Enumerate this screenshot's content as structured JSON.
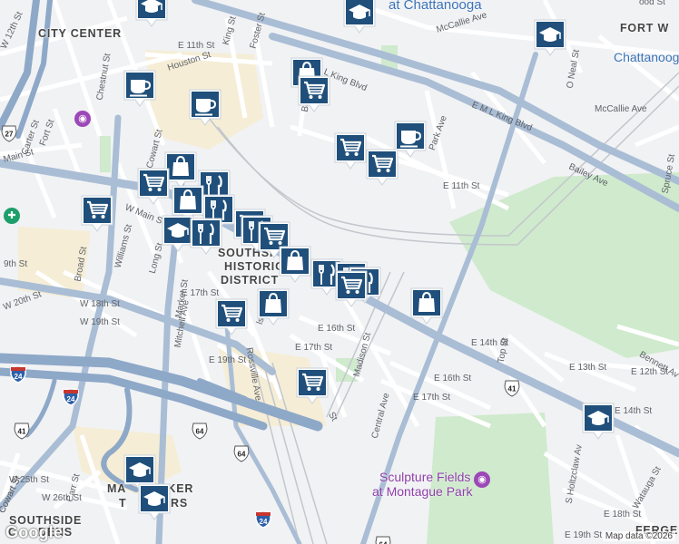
{
  "map": {
    "attribution": "Map data ©2026",
    "logo": "Google",
    "colors": {
      "highway": "#8ea8c8",
      "major": "#a9bdd5",
      "park": "#cfeacd",
      "campus": "#f5edd6",
      "pin": "#1f4f7a",
      "water": "#a6d4f0",
      "poi": "#8e3fa8"
    }
  },
  "areas": {
    "city_center": "CITY CENTER",
    "fort_wood": "FORT W",
    "southside_historic_1": "SOUTHSI",
    "southside_historic_2": "HISTORIC",
    "southside_historic_3": "DISTRICT",
    "main_street_1": "MA",
    "main_street_2": "LKER",
    "main_street_3": "T",
    "main_street_4": "RS",
    "southside_1": "SOUTHSIDE",
    "southside_2": "G",
    "southside_3": "DENS",
    "fergeson": "FERGE"
  },
  "pois": {
    "utc": "at Chattanooga",
    "chattanooga_right": "Chattanoog",
    "sculpture_1": "Sculpture Fields",
    "sculpture_2": "at Montague Park"
  },
  "streets": [
    {
      "id": "mccallie-1",
      "text": "McCallie Ave"
    },
    {
      "id": "mccallie-2",
      "text": "McCallie Ave"
    },
    {
      "id": "mlk-1",
      "text": "E M L King Blvd"
    },
    {
      "id": "mlk-2",
      "text": "E M L King Blvd"
    },
    {
      "id": "bailey",
      "text": "Bailey Ave"
    },
    {
      "id": "w-main",
      "text": "W Main St"
    },
    {
      "id": "main",
      "text": "Main St"
    },
    {
      "id": "e-11th-1",
      "text": "E 11th St"
    },
    {
      "id": "e-11th-2",
      "text": "E 11th St"
    },
    {
      "id": "w-12th",
      "text": "W 12th St"
    },
    {
      "id": "houston",
      "text": "Houston St"
    },
    {
      "id": "king",
      "text": "King St"
    },
    {
      "id": "foster",
      "text": "Foster St"
    },
    {
      "id": "baldwin",
      "text": "Baldwin St"
    },
    {
      "id": "park-ave",
      "text": "Park Ave"
    },
    {
      "id": "o-neal",
      "text": "O Neal St"
    },
    {
      "id": "spruce",
      "text": "Spruce St"
    },
    {
      "id": "chestnut",
      "text": "Chestnut St"
    },
    {
      "id": "carter",
      "text": "Carter St"
    },
    {
      "id": "fort",
      "text": "Fort St"
    },
    {
      "id": "cowart-1",
      "text": "Cowart St"
    },
    {
      "id": "cowart-2",
      "text": "Cowart St"
    },
    {
      "id": "broad",
      "text": "Broad St"
    },
    {
      "id": "williams",
      "text": "Williams St"
    },
    {
      "id": "long",
      "text": "Long St"
    },
    {
      "id": "market",
      "text": "Market St"
    },
    {
      "id": "mitchell",
      "text": "Mitchell Ave"
    },
    {
      "id": "rossville",
      "text": "Rossville Ave"
    },
    {
      "id": "w-20th",
      "text": "W 20th St"
    },
    {
      "id": "w-18th",
      "text": "W 18th St"
    },
    {
      "id": "w-19th",
      "text": "W 19th St"
    },
    {
      "id": "e-17th-w",
      "text": "E 17th St"
    },
    {
      "id": "e-19th",
      "text": "E 19th St"
    },
    {
      "id": "e-16th-1",
      "text": "E 16th St"
    },
    {
      "id": "e-17th-1",
      "text": "E 17th St"
    },
    {
      "id": "madison",
      "text": "Madison St"
    },
    {
      "id": "central",
      "text": "Central Ave"
    },
    {
      "id": "e-14th-1",
      "text": "E 14th St"
    },
    {
      "id": "e-16th-2",
      "text": "E 16th St"
    },
    {
      "id": "e-17th-2",
      "text": "E 17th St"
    },
    {
      "id": "top",
      "text": "Top St"
    },
    {
      "id": "e-13th",
      "text": "E 13th St"
    },
    {
      "id": "e-12th",
      "text": "E 12th St"
    },
    {
      "id": "bennett",
      "text": "Bennett Av"
    },
    {
      "id": "e-14th-2",
      "text": "E 14th St"
    },
    {
      "id": "holtzclaw",
      "text": "S Holtzclaw Av"
    },
    {
      "id": "e-18th",
      "text": "E 18th St"
    },
    {
      "id": "e-19th-2",
      "text": "E 19th St"
    },
    {
      "id": "watauga",
      "text": "Watauga St"
    },
    {
      "id": "w-25th",
      "text": "W 25th St"
    },
    {
      "id": "w-26th",
      "text": "W 26th St"
    },
    {
      "id": "carr",
      "text": "Carr St"
    },
    {
      "id": "cowart-3",
      "text": "Cowart St"
    },
    {
      "id": "19th-w",
      "text": "9th St"
    },
    {
      "id": "wood",
      "text": "ood St"
    },
    {
      "id": "st-mid",
      "text": "St"
    },
    {
      "id": "ls",
      "text": "ls"
    }
  ],
  "shields": [
    {
      "id": "i24-a",
      "text": "24",
      "kind": "interstate"
    },
    {
      "id": "i24-b",
      "text": "24",
      "kind": "interstate"
    },
    {
      "id": "i24-c",
      "text": "24",
      "kind": "interstate"
    },
    {
      "id": "us41-a",
      "text": "41",
      "kind": "us"
    },
    {
      "id": "us41-b",
      "text": "41",
      "kind": "us"
    },
    {
      "id": "us64-a",
      "text": "64",
      "kind": "us"
    },
    {
      "id": "us64-b",
      "text": "64",
      "kind": "us"
    },
    {
      "id": "us64-c",
      "text": "64",
      "kind": "us"
    },
    {
      "id": "us27",
      "text": "27",
      "kind": "us"
    }
  ],
  "pins": [
    {
      "id": "p1",
      "icon": "graduation-cap-icon"
    },
    {
      "id": "p2",
      "icon": "graduation-cap-icon"
    },
    {
      "id": "p3",
      "icon": "graduation-cap-icon"
    },
    {
      "id": "p4",
      "icon": "shopping-bag-icon"
    },
    {
      "id": "p5",
      "icon": "shopping-cart-icon"
    },
    {
      "id": "p6",
      "icon": "coffee-cup-icon"
    },
    {
      "id": "p7",
      "icon": "coffee-cup-icon"
    },
    {
      "id": "p8",
      "icon": "coffee-cup-icon"
    },
    {
      "id": "p9",
      "icon": "shopping-cart-icon"
    },
    {
      "id": "p10",
      "icon": "shopping-cart-icon"
    },
    {
      "id": "p11",
      "icon": "shopping-bag-icon"
    },
    {
      "id": "p12",
      "icon": "shopping-cart-icon"
    },
    {
      "id": "p13",
      "icon": "fork-knife-icon"
    },
    {
      "id": "p14",
      "icon": "shopping-bag-icon"
    },
    {
      "id": "p15",
      "icon": "shopping-cart-icon"
    },
    {
      "id": "p16",
      "icon": "fork-knife-icon"
    },
    {
      "id": "p17",
      "icon": "graduation-cap-icon"
    },
    {
      "id": "p18",
      "icon": "fork-knife-icon"
    },
    {
      "id": "p19",
      "icon": "shopping-cart-icon"
    },
    {
      "id": "p20",
      "icon": "fork-knife-icon"
    },
    {
      "id": "p21",
      "icon": "shopping-cart-icon"
    },
    {
      "id": "p22",
      "icon": "shopping-bag-icon"
    },
    {
      "id": "p23",
      "icon": "fork-knife-icon"
    },
    {
      "id": "p24",
      "icon": "shopping-cart-icon"
    },
    {
      "id": "p25",
      "icon": "fork-knife-icon"
    },
    {
      "id": "p26",
      "icon": "fork-knife-icon"
    },
    {
      "id": "p27",
      "icon": "shopping-bag-icon"
    },
    {
      "id": "p28",
      "icon": "shopping-bag-icon"
    },
    {
      "id": "p29",
      "icon": "shopping-cart-icon"
    },
    {
      "id": "p30",
      "icon": "shopping-cart-icon"
    },
    {
      "id": "p31",
      "icon": "graduation-cap-icon"
    },
    {
      "id": "p32",
      "icon": "graduation-cap-icon"
    },
    {
      "id": "p33",
      "icon": "graduation-cap-icon"
    }
  ]
}
